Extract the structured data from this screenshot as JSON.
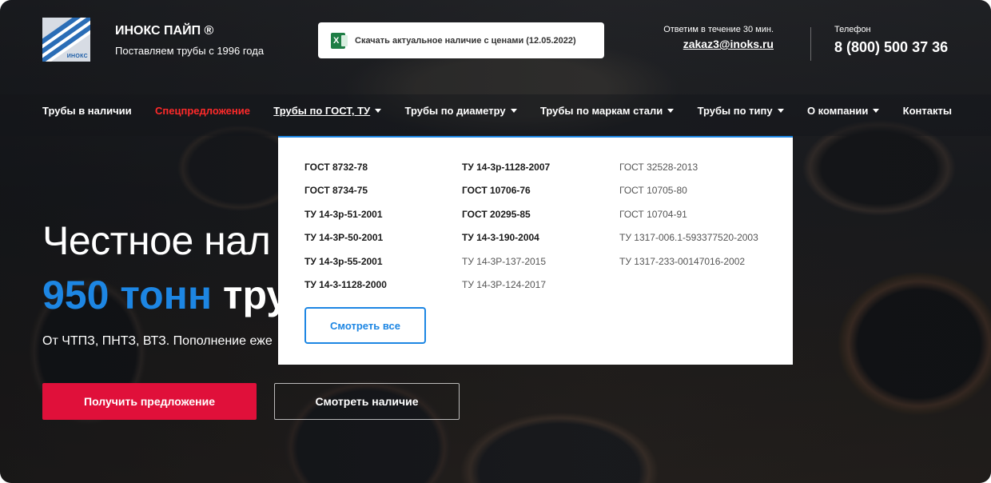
{
  "header": {
    "brand_name": "ИНОКС ПАЙП ®",
    "brand_tagline": "Поставляем трубы с 1996 года",
    "logo_word": "ИНОКС",
    "download_label": "Скачать актуальное наличие с ценами (12.05.2022)",
    "reply_note": "Ответим в течение 30 мин.",
    "email": "zakaz3@inoks.ru",
    "phone_label": "Телефон",
    "phone": "8 (800) 500 37 36"
  },
  "nav": {
    "items": [
      {
        "label": "Трубы в наличии"
      },
      {
        "label": "Спецпредложение"
      },
      {
        "label": "Трубы по ГОСТ, ТУ"
      },
      {
        "label": "Трубы по диаметру"
      },
      {
        "label": "Трубы по маркам стали"
      },
      {
        "label": "Трубы по типу"
      },
      {
        "label": "О компании"
      },
      {
        "label": "Контакты"
      }
    ]
  },
  "dropdown": {
    "col1": [
      "ГОСТ 8732-78",
      "ГОСТ 8734-75",
      "ТУ 14-3р-51-2001",
      "ТУ 14-3Р-50-2001",
      "ТУ 14-3р-55-2001",
      "ТУ 14-3-1128-2000"
    ],
    "col2": [
      "ТУ 14-3р-1128-2007",
      "ГОСТ 10706-76",
      "ГОСТ 20295-85",
      "ТУ 14-3-190-2004",
      "ТУ 14-3Р-137-2015",
      "ТУ 14-3Р-124-2017"
    ],
    "col3": [
      "ГОСТ 32528-2013",
      "ГОСТ 10705-80",
      "ГОСТ 10704-91",
      "ТУ 1317-006.1-593377520-2003",
      "ТУ 1317-233-00147016-2002"
    ],
    "see_all": "Смотреть все"
  },
  "hero": {
    "title": "Честное нал",
    "accent": "950 тонн",
    "rest": " тру",
    "text": "От ЧТПЗ, ПНТЗ, ВТЗ. Пополнение еже",
    "primary_button": "Получить предложение",
    "secondary_button": "Смотреть наличие"
  },
  "colors": {
    "accent": "#1d86e3",
    "cta": "#e0103a",
    "special": "#ff2a2a"
  }
}
